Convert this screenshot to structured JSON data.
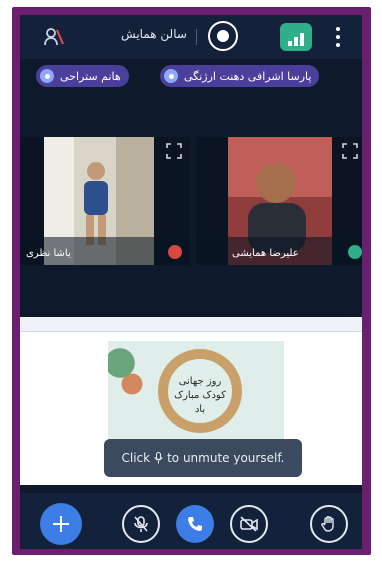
{
  "header": {
    "title": "سالن همایش",
    "icons": {
      "participants": "user-mic-off-icon",
      "record": "record-icon",
      "stats": "connection-status-icon",
      "more": "more-vertical-icon"
    }
  },
  "presenters": [
    {
      "label": "پارسا اشرافی  دهنت ارژنگی"
    },
    {
      "label": "هانم ستراحی"
    }
  ],
  "tiles": [
    {
      "name": "یاشا نظری",
      "badge": "muted"
    },
    {
      "name": "علیرضا همایشی",
      "badge": "speaking"
    }
  ],
  "shared_screen": {
    "slide_line_1": "روز جهانی",
    "slide_line_2": "کودک مبارک باد"
  },
  "toast": {
    "prefix": "Click",
    "suffix": "to unmute yourself."
  },
  "actions": {
    "add": "plus-icon",
    "mute": "microphone-off-icon",
    "phone": "phone-icon",
    "camera": "video-off-icon",
    "raise_hand": "hand-icon"
  },
  "colors": {
    "frame": "#6b1f6f",
    "background": "#0e1a2b",
    "accent": "#3d7ee6",
    "chip": "#4b3f9b",
    "stats": "#2fae8a"
  }
}
